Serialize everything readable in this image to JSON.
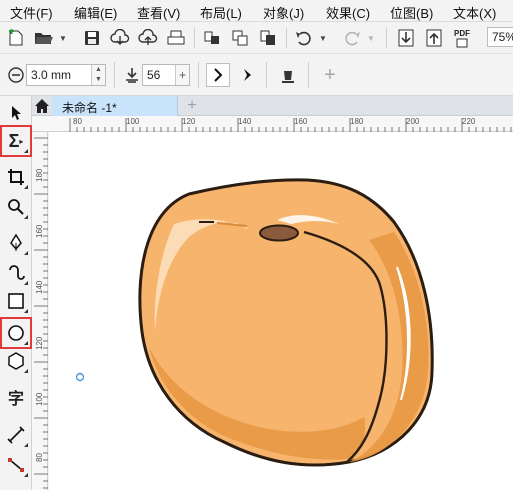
{
  "menu": {
    "items": [
      "文件(F)",
      "编辑(E)",
      "查看(V)",
      "布局(L)",
      "对象(J)",
      "效果(C)",
      "位图(B)",
      "文本(X)"
    ]
  },
  "toolbar": {
    "zoom": "75%",
    "pdf_label": "PDF"
  },
  "propertybar": {
    "outline_width": "3.0 mm",
    "value_56": "56"
  },
  "document": {
    "tab_title": "未命名 -1*"
  },
  "rulers": {
    "top_labels": [
      "80",
      "100",
      "120",
      "140",
      "160",
      "180",
      "200",
      "220"
    ],
    "left_labels": [
      "180",
      "160",
      "140",
      "120",
      "100",
      "80"
    ]
  },
  "icons": {
    "pick": "pick-tool-icon",
    "shape": "shape-tool-icon",
    "crop": "crop-tool-icon",
    "zoom": "zoom-tool-icon",
    "pen": "pen-tool-icon",
    "curve": "curve-tool-icon",
    "rectangle": "rectangle-tool-icon",
    "ellipse": "ellipse-tool-icon",
    "polygon": "polygon-tool-icon",
    "text": "text-tool-icon",
    "line": "parallel-dimension-icon",
    "connector": "connector-tool-icon"
  },
  "colors": {
    "highlight": "#e03a3a",
    "peach_base": "#f6b46c",
    "peach_shadow": "#e89a47",
    "tab_active": "#c9e4fa"
  }
}
